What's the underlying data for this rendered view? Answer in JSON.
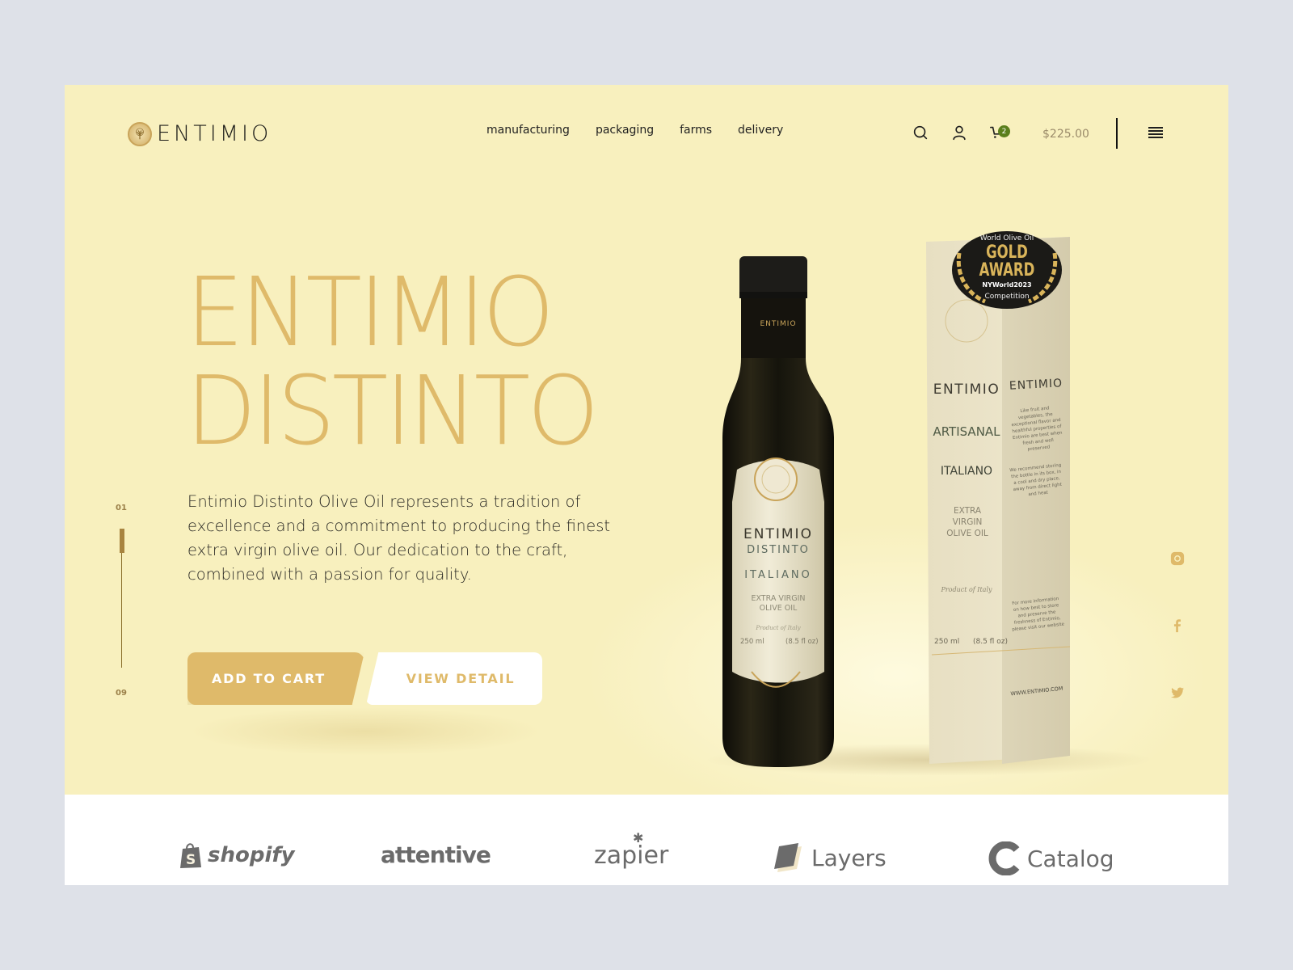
{
  "brand": {
    "name": "ENTIMIO"
  },
  "nav": {
    "items": [
      {
        "label": "manufacturing"
      },
      {
        "label": "packaging"
      },
      {
        "label": "farms"
      },
      {
        "label": "delivery"
      }
    ]
  },
  "header": {
    "icons": [
      "search-icon",
      "user-icon",
      "cart-icon",
      "menu-icon"
    ],
    "cart_count": "2",
    "cart_total": "$225.00"
  },
  "hero": {
    "title_line1": "ENTIMIO",
    "title_line2": "DISTINTO",
    "description": "Entimio Distinto Olive Oil represents a tradition of excellence and a commitment to producing the finest extra virgin olive oil. Our dedication to the craft, combined with a passion for quality.",
    "add_to_cart_label": "ADD TO CART",
    "view_detail_label": "VIEW DETAIL"
  },
  "slider": {
    "current": "01",
    "total": "09",
    "progress": 0.11
  },
  "social": [
    "instagram-icon",
    "facebook-icon",
    "twitter-icon"
  ],
  "product": {
    "bottle_label": {
      "neck": "ENTIMIO",
      "brand": "ENTIMIO",
      "line": "DISTINTO",
      "origin": "ITALIANO",
      "type": "EXTRA VIRGIN OLIVE OIL",
      "tagline": "Product of Italy",
      "volume_ml": "250 ml",
      "volume_oz": "(8.5 fl oz)"
    },
    "box_front": {
      "brand": "ENTIMIO",
      "line": "ARTISANAL",
      "origin": "ITALIANO",
      "type": "EXTRA VIRGIN OLIVE OIL",
      "tagline": "Product of Italy",
      "volume_ml": "250 ml",
      "volume_oz": "(8.5 fl oz)"
    },
    "box_side": {
      "brand": "ENTIMIO",
      "text1": "Like fruit and vegetables, the exceptional flavor and healthful properties of Entimio are best when fresh and well preserved",
      "text2": "We recommend storing the bottle in its box, in a cool and dry place, away from direct light and heat",
      "text3": "For more information on how best to store and preserve the freshness of Entimio, please visit our website",
      "website": "WWW.ENTIMIO.COM"
    },
    "award": {
      "top": "World Olive Oil",
      "line1": "GOLD",
      "line2": "AWARD",
      "event": "NYWorld2023",
      "bottom": "Competition"
    }
  },
  "partners": [
    {
      "name": "shopify"
    },
    {
      "name": "attentive"
    },
    {
      "name": "zapier"
    },
    {
      "name": "Layers"
    },
    {
      "name": "Catalog"
    }
  ],
  "colors": {
    "hero_bg": "#f8f0be",
    "accent_gold": "#dfba6a",
    "badge_green": "#5b7f1c",
    "page_bg": "#dee1e8"
  }
}
